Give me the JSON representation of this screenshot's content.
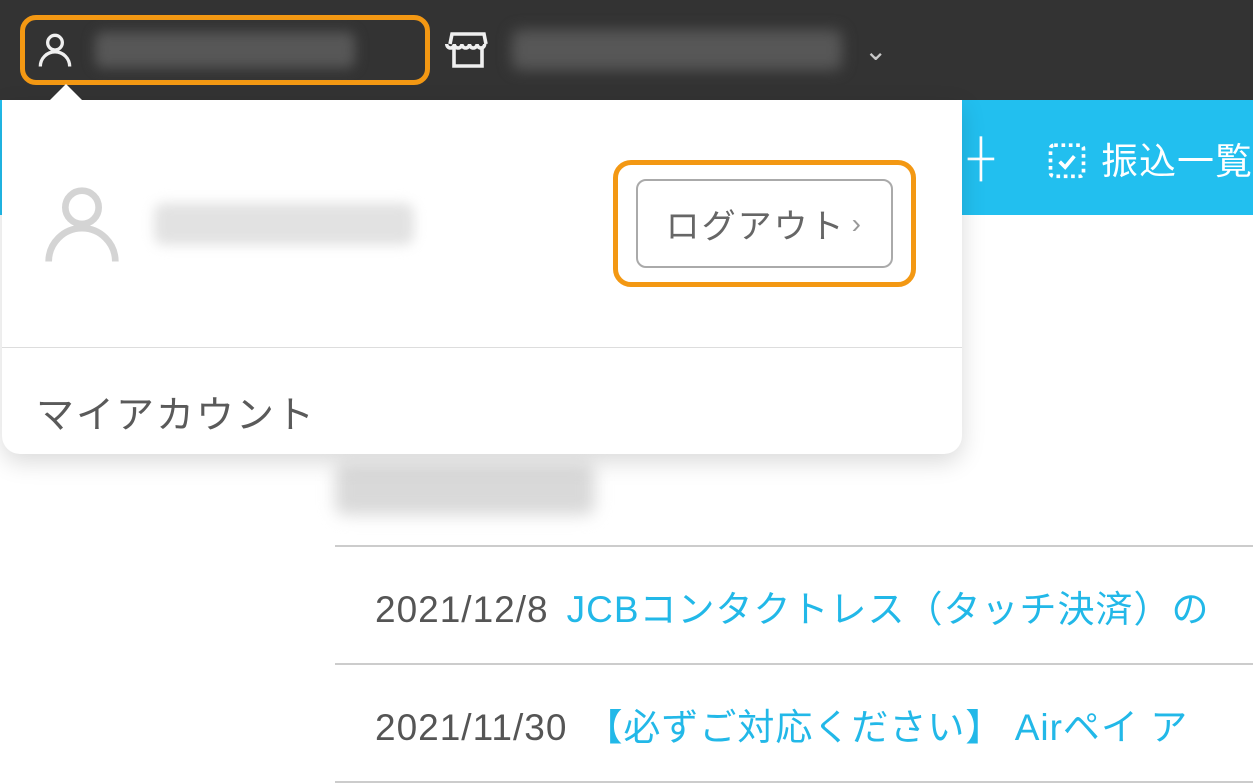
{
  "topbar": {
    "user_name_blurred": true,
    "store_name_blurred": true
  },
  "bluebar": {
    "item1_suffix": "┼",
    "item2_label": "振込一覧"
  },
  "dropdown": {
    "logout_label": "ログアウト",
    "my_account_label": "マイアカウント"
  },
  "news": [
    {
      "date": "2021/12/8",
      "title": "JCBコンタクトレス（タッチ決済）の"
    },
    {
      "date": "2021/11/30",
      "title": "【必ずご対応ください】 Airペイ ア"
    }
  ]
}
